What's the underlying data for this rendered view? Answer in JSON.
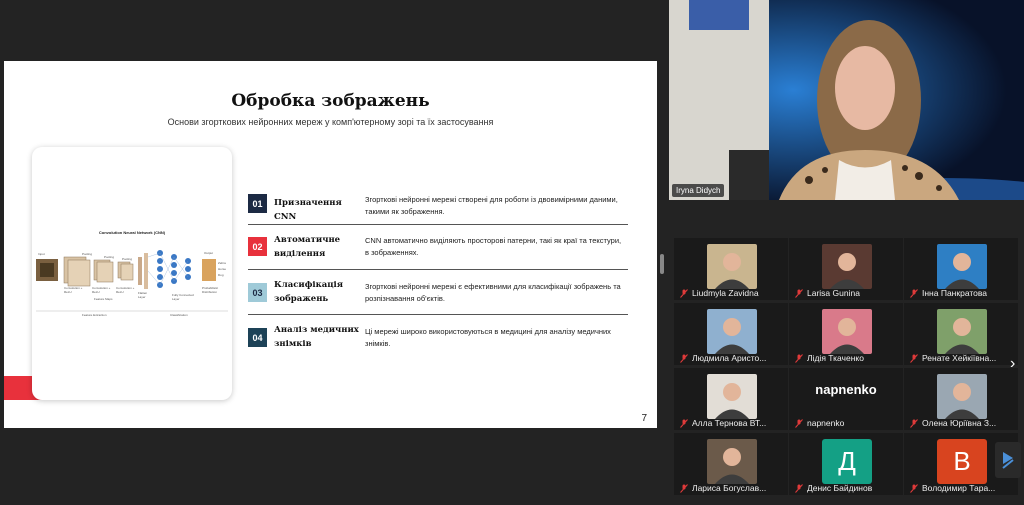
{
  "slide": {
    "title": "Обробка зображень",
    "subtitle": "Основи згорткових нейронних мереж у комп'ютерному зорі та їх застосування",
    "page_number": "7",
    "figure": {
      "title": "Convolution Neural Network (CNN)",
      "labels": [
        "Input",
        "Pooling",
        "Pooling",
        "Pooling",
        "Output",
        "Convolution + ReLU",
        "Convolution + ReLU",
        "Convolution + ReLU",
        "Flatten Layer",
        "Feature Maps",
        "Fully Connected Layer",
        "Probabilistic Distribution",
        "Feature Extraction",
        "Classification",
        "Zebra",
        "Horse",
        "Dog"
      ]
    },
    "items": [
      {
        "num": "01",
        "title": "Призначення CNN",
        "desc": "Згорткові нейронні мережі створені для роботи із двовимірними даними, такими як зображення.",
        "color": "#1c2a44"
      },
      {
        "num": "02",
        "title": "Автоматичне виділення",
        "desc": "CNN автоматично виділяють просторові патерни, такі як краї та текстури, в зображеннях.",
        "color": "#e8313c"
      },
      {
        "num": "03",
        "title": "Класифікація зображень",
        "desc": "Згорткові нейронні мережі є ефективними для класифікації зображень та розпізнавання об'єктів.",
        "color": "#9fcad8"
      },
      {
        "num": "04",
        "title": "Аналіз медичних знімків",
        "desc": "Ці мережі широко використовуються в медицині для аналізу медичних знімків.",
        "color": "#1d4257"
      }
    ]
  },
  "speaker": {
    "name": "Iryna Didych"
  },
  "participants": [
    {
      "name": "Liudmyla Zavidna",
      "kind": "photo",
      "bg": "#c9b58f"
    },
    {
      "name": "Larisa Gunina",
      "kind": "photo",
      "bg": "#5a3a32"
    },
    {
      "name": "Інна Панкратова",
      "kind": "photo",
      "bg": "#2e7fc4"
    },
    {
      "name": "Людмила Аристо...",
      "kind": "photo",
      "bg": "#8fb0cf"
    },
    {
      "name": "Лідія Ткаченко",
      "kind": "photo",
      "bg": "#d97a8a"
    },
    {
      "name": "Ренате Хейкіївна...",
      "kind": "photo",
      "bg": "#7fa06a"
    },
    {
      "name": "Алла Тернова ВТ...",
      "kind": "photo",
      "bg": "#e2ddd6"
    },
    {
      "name": "napnenko",
      "kind": "text",
      "display": "napnenko"
    },
    {
      "name": "Олена Юріївна З...",
      "kind": "photo",
      "bg": "#9aa7b2"
    },
    {
      "name": "Лариса Богуслав...",
      "kind": "photo",
      "bg": "#6b5a4a"
    },
    {
      "name": "Денис Байдинов",
      "kind": "letter",
      "letter": "Д",
      "bg": "#14a085"
    },
    {
      "name": "Володимир Тара...",
      "kind": "letter",
      "letter": "В",
      "bg": "#d8441f"
    }
  ],
  "nav": {
    "next_icon": "chevron-right-icon",
    "next_glyph": "›"
  }
}
